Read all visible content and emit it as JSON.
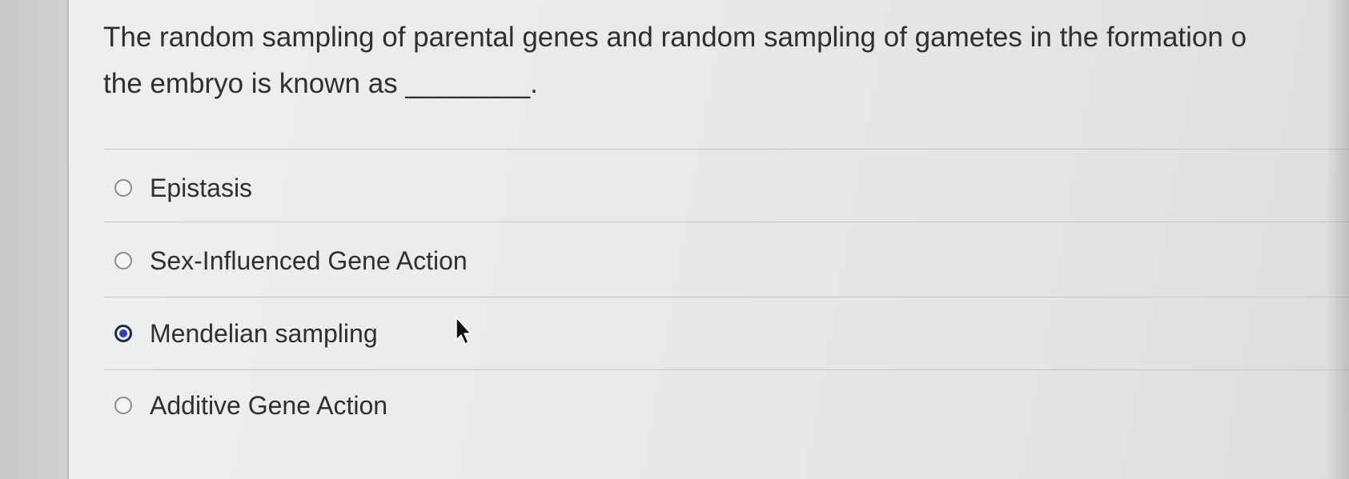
{
  "question": {
    "line1": "The random sampling of parental genes and random sampling of gametes in the formation o",
    "line2": "the embryo is known as ________."
  },
  "options": [
    {
      "label": "Epistasis",
      "selected": false
    },
    {
      "label": "Sex-Influenced Gene Action",
      "selected": false
    },
    {
      "label": "Mendelian sampling",
      "selected": true
    },
    {
      "label": "Additive Gene Action",
      "selected": false
    }
  ],
  "colors": {
    "radio_selected_fill": "#2b3fc8",
    "radio_selected_ring": "#1e2a4a",
    "text": "#2e2f31"
  },
  "icons": {
    "cursor": "mouse-pointer-arrow-icon"
  }
}
